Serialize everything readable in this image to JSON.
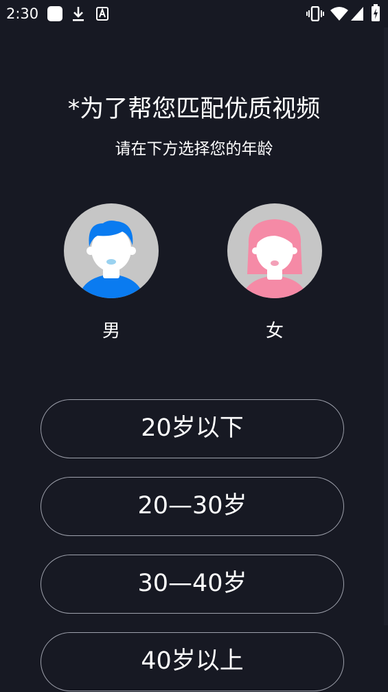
{
  "status_bar": {
    "time": "2:30",
    "left_icons": [
      "app-notification-icon",
      "download-icon",
      "font-icon"
    ],
    "right_icons": [
      "vibrate-icon",
      "wifi-icon",
      "cellular-signal-icon",
      "battery-charging-icon"
    ]
  },
  "header": {
    "title": "*为了帮您匹配优质视频",
    "subtitle": "请在下方选择您的年龄"
  },
  "gender": {
    "male_label": "男",
    "female_label": "女",
    "male_color": "#0a7bf0",
    "female_color": "#f58aa6",
    "avatar_bg": "#c6c6c6"
  },
  "age_options": [
    {
      "label": "20岁以下"
    },
    {
      "label": "20—30岁"
    },
    {
      "label": "30—40岁"
    },
    {
      "label": "40岁以上"
    }
  ],
  "colors": {
    "background": "#171923",
    "button_border": "#9fa2ad",
    "text": "#ffffff"
  }
}
